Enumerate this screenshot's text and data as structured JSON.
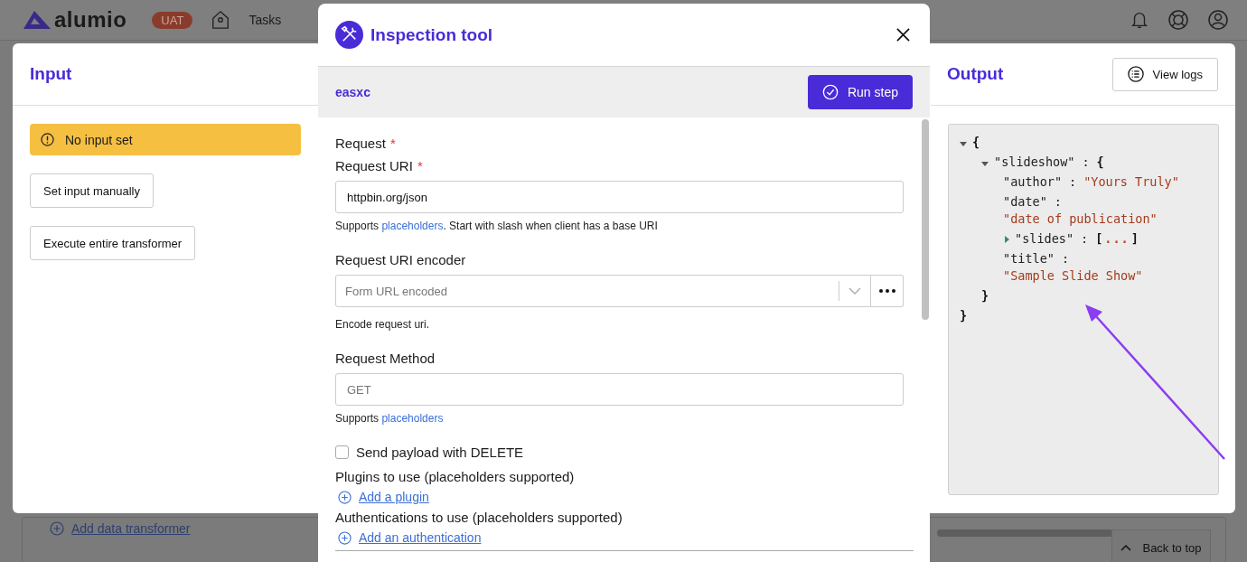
{
  "nav": {
    "logo": "alumio",
    "env_badge": "UAT",
    "links": [
      "Tasks"
    ]
  },
  "background": {
    "add_link": "Add data transformer",
    "back_to_top": "Back to top"
  },
  "input": {
    "title": "Input",
    "alert": "No input set",
    "buttons": [
      "Set input manually",
      "Execute entire transformer"
    ]
  },
  "output": {
    "title": "Output",
    "view_logs": "View logs",
    "tree": {
      "open": "{",
      "close": "}",
      "expanded": true,
      "children": [
        {
          "key": "\"slideshow\"",
          "sep": ":",
          "open": "{",
          "close": "}",
          "expanded": true,
          "children": [
            {
              "key": "\"author\"",
              "sep": ":",
              "value": "\"Yours Truly\""
            },
            {
              "key": "\"date\"",
              "sep": ":",
              "value": "\"date of publication\""
            },
            {
              "key": "\"slides\"",
              "sep": ":",
              "open": "[",
              "ellipsis": "...",
              "close": "]",
              "expanded": false
            },
            {
              "key": "\"title\"",
              "sep": ":",
              "value": "\"Sample Slide Show\""
            }
          ]
        }
      ]
    }
  },
  "modal": {
    "title": "Inspection tool",
    "step": "easxc",
    "run_button": "Run step",
    "fields": [
      {
        "kind": "heading",
        "label": "Request",
        "marker": "*"
      },
      {
        "kind": "text",
        "label": "Request URI",
        "marker": "*",
        "value": "httpbin.org/json",
        "help": {
          "before": "Supports ",
          "link": "placeholders",
          "after": ". Start with slash when client has a base URI"
        }
      },
      {
        "kind": "select",
        "label": "Request URI encoder",
        "placeholder": "Form URL encoded",
        "help": {
          "before": "Encode request uri."
        }
      },
      {
        "kind": "text",
        "label": "Request Method",
        "placeholder": "GET",
        "help": {
          "before": "Supports ",
          "link": "placeholders"
        }
      },
      {
        "kind": "checkbox",
        "label": "Send payload with DELETE",
        "checked": false
      },
      {
        "kind": "collection",
        "label": "Plugins to use (placeholders supported)",
        "action": "Add a plugin"
      },
      {
        "kind": "collection",
        "label": "Authentications to use (placeholders supported)",
        "action": "Add an authentication"
      }
    ]
  }
}
